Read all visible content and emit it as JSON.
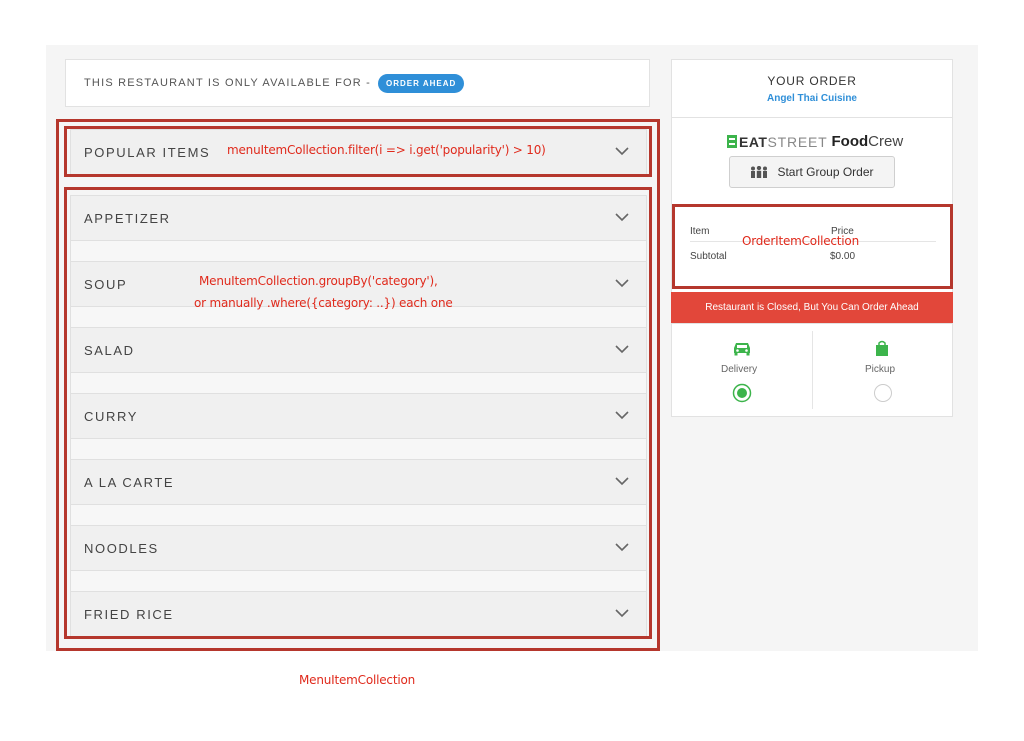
{
  "banner": {
    "text": "THIS RESTAURANT IS ONLY AVAILABLE FOR -",
    "badge": "ORDER AHEAD"
  },
  "categories": [
    "POPULAR ITEMS",
    "APPETIZER",
    "SOUP",
    "SALAD",
    "CURRY",
    "A LA CARTE",
    "NOODLES",
    "FRIED RICE"
  ],
  "order": {
    "title": "YOUR ORDER",
    "restaurant": "Angel Thai Cuisine",
    "foodcrew": {
      "eat": "EAT",
      "street": "STREET",
      "food": "Food",
      "crew": "Crew"
    },
    "group_order_button": "Start Group Order",
    "col_item": "Item",
    "col_price": "Price",
    "subtotal_label": "Subtotal",
    "subtotal_value": "$0.00",
    "closed_notice": "Restaurant is Closed, But You Can Order Ahead",
    "delivery_label": "Delivery",
    "pickup_label": "Pickup",
    "selected_option": "Delivery"
  },
  "annotations": {
    "popular": "menuItemCollection.filter(i => i.get('popularity') > 10)",
    "grouped_line1": "MenuItemCollection.groupBy('category'),",
    "grouped_line2": "or manually .where({category: ..}) each one",
    "order_items": "OrderItemCollection",
    "menu": "MenuItemCollection"
  },
  "colors": {
    "accent_blue": "#2f8fd8",
    "closed_red": "#e2473a",
    "annotation_red": "#e02a1c",
    "box_red": "#b5372d",
    "green": "#3cb44b"
  }
}
